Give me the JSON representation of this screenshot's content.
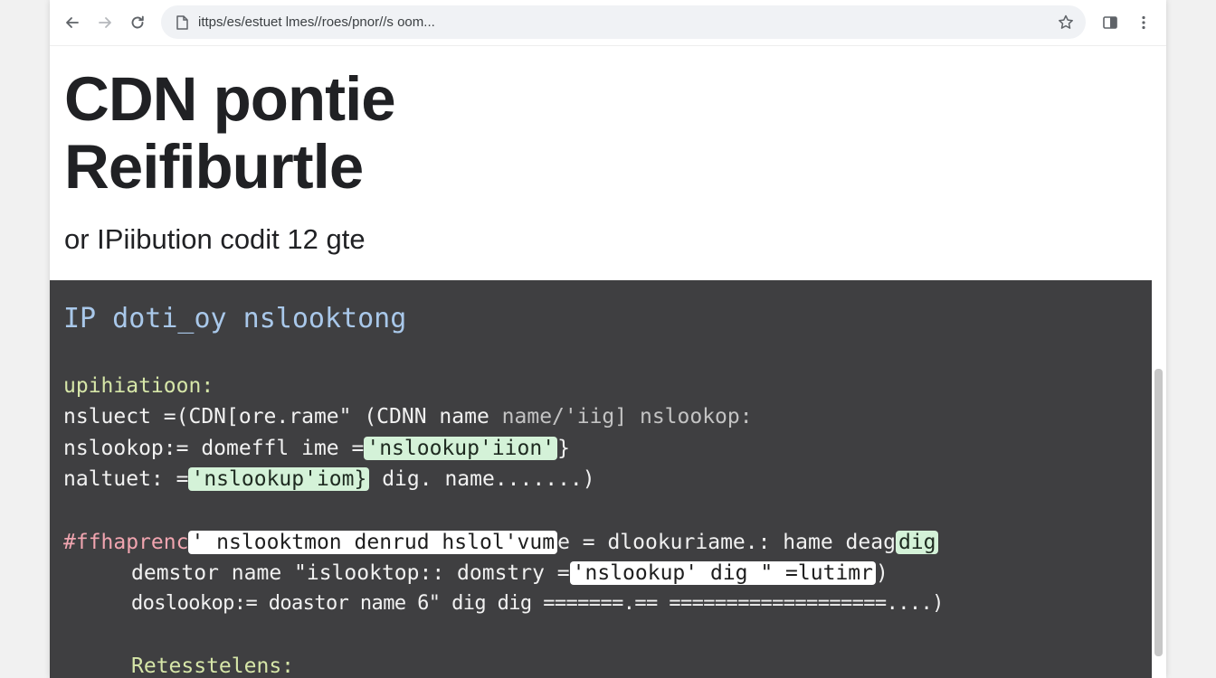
{
  "browser": {
    "url": "ittps/es/estuet lmes//roes/pnor//s oom...",
    "back_icon": "back-arrow-icon",
    "forward_icon": "forward-arrow-icon",
    "reload_icon": "reload-icon",
    "bookmark_icon": "star-icon",
    "sidebar_icon": "sidebar-toggle-icon",
    "menu_icon": "kebab-menu-icon"
  },
  "page": {
    "title_line1": "CDN pontie",
    "title_line2": "Reifiburtle",
    "subtitle": "or IPiibution codit 12 gte"
  },
  "code": {
    "heading": "IP doti_oy nslooktong",
    "section1_label": "upihiatioon:",
    "line1": "nsluect =(CDN[ore.rame\" (CDNN name ",
    "line1_dim": "name/'iig] nslookop:",
    "line2_a": "nslookop:= domeffl ime =",
    "line2_hl": "'nslookup'iion'",
    "line2_b": "}",
    "line3_a": "naltuet: =",
    "line3_hl": "'nslookup'iom}",
    "line3_b": " dig. name.......)",
    "line4_a": "#ffhaprenc",
    "line4_hl": "' nslooktmon denrud hslol'vum",
    "line4_b": "e = dlookuriame.: hame deag",
    "line4_hl2": "dig",
    "line5_a": "demstor name \"islooktop:: domstry =",
    "line5_hl": "'nslookup' dig \" =lutimr",
    "line5_b": ")",
    "line6": "doslookop:= doastor name 6\" dig dig =======.== ===================....)",
    "section2_label": "Retesstelens:"
  },
  "colors": {
    "code_background": "#3f3f41",
    "heading_blue": "#a9c8ea",
    "label_green": "#d6e6a8",
    "comment_pink": "#f1a5b0",
    "highlight_green": "#d4f2d8"
  }
}
